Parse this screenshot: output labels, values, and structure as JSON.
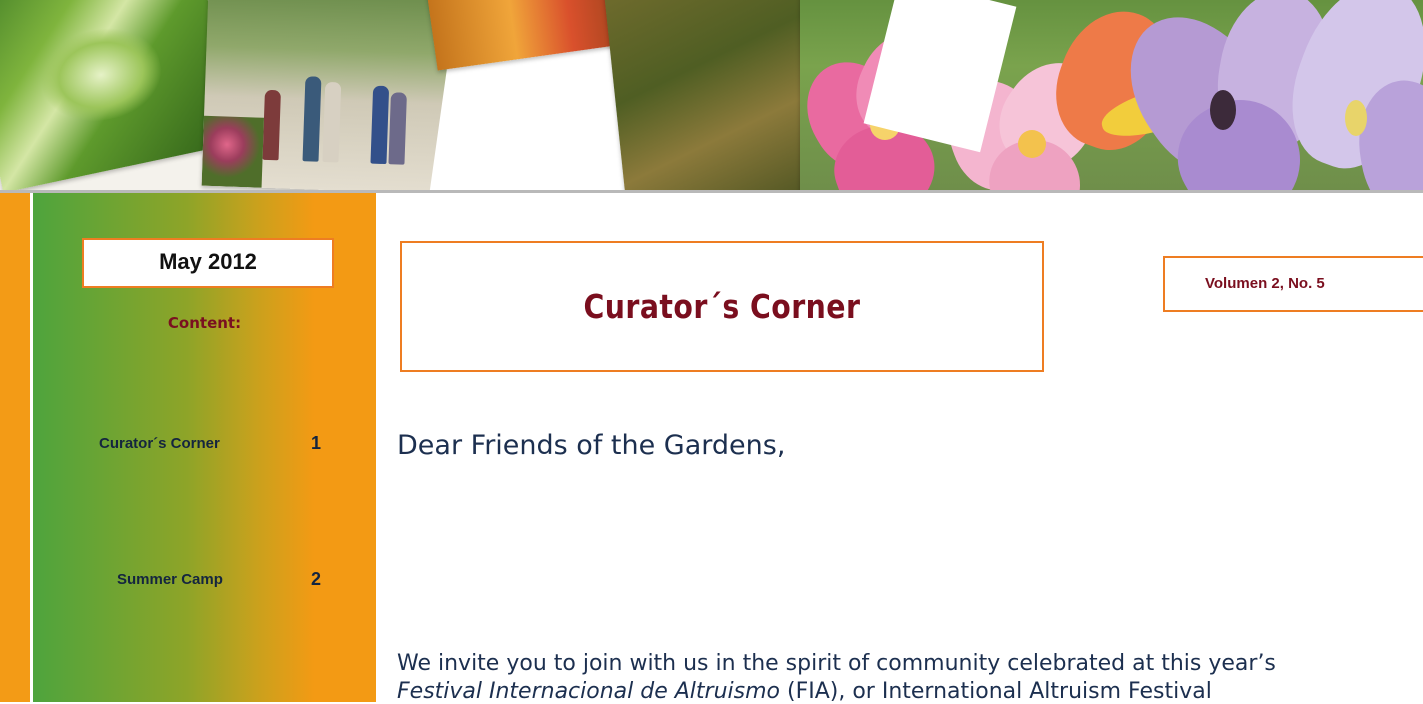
{
  "masthead": {
    "banner_image": "garden-photo-collage"
  },
  "sidebar": {
    "date": "May 2012",
    "contents_heading": "Content:",
    "toc": [
      {
        "label": "Curator´s Corner",
        "page": "1"
      },
      {
        "label": "Summer Camp",
        "page": "2"
      }
    ]
  },
  "article": {
    "title": "Curator´s Corner",
    "volume": "Volumen 2,   No. 5",
    "greeting": "Dear Friends of the Gardens,",
    "body_line1": "We invite you to join with us in the spirit of community celebrated at this year’s",
    "body_line2_italic": "Festival Internacional de Altruismo",
    "body_line2_rest": " (FIA), or International Altruism Festival"
  },
  "colors": {
    "accent_orange": "#f39b16",
    "box_border": "#ee7d22",
    "title_maroon": "#7a0e1e",
    "body_navy": "#1c2f4f",
    "sidebar_green": "#4ea43d"
  }
}
